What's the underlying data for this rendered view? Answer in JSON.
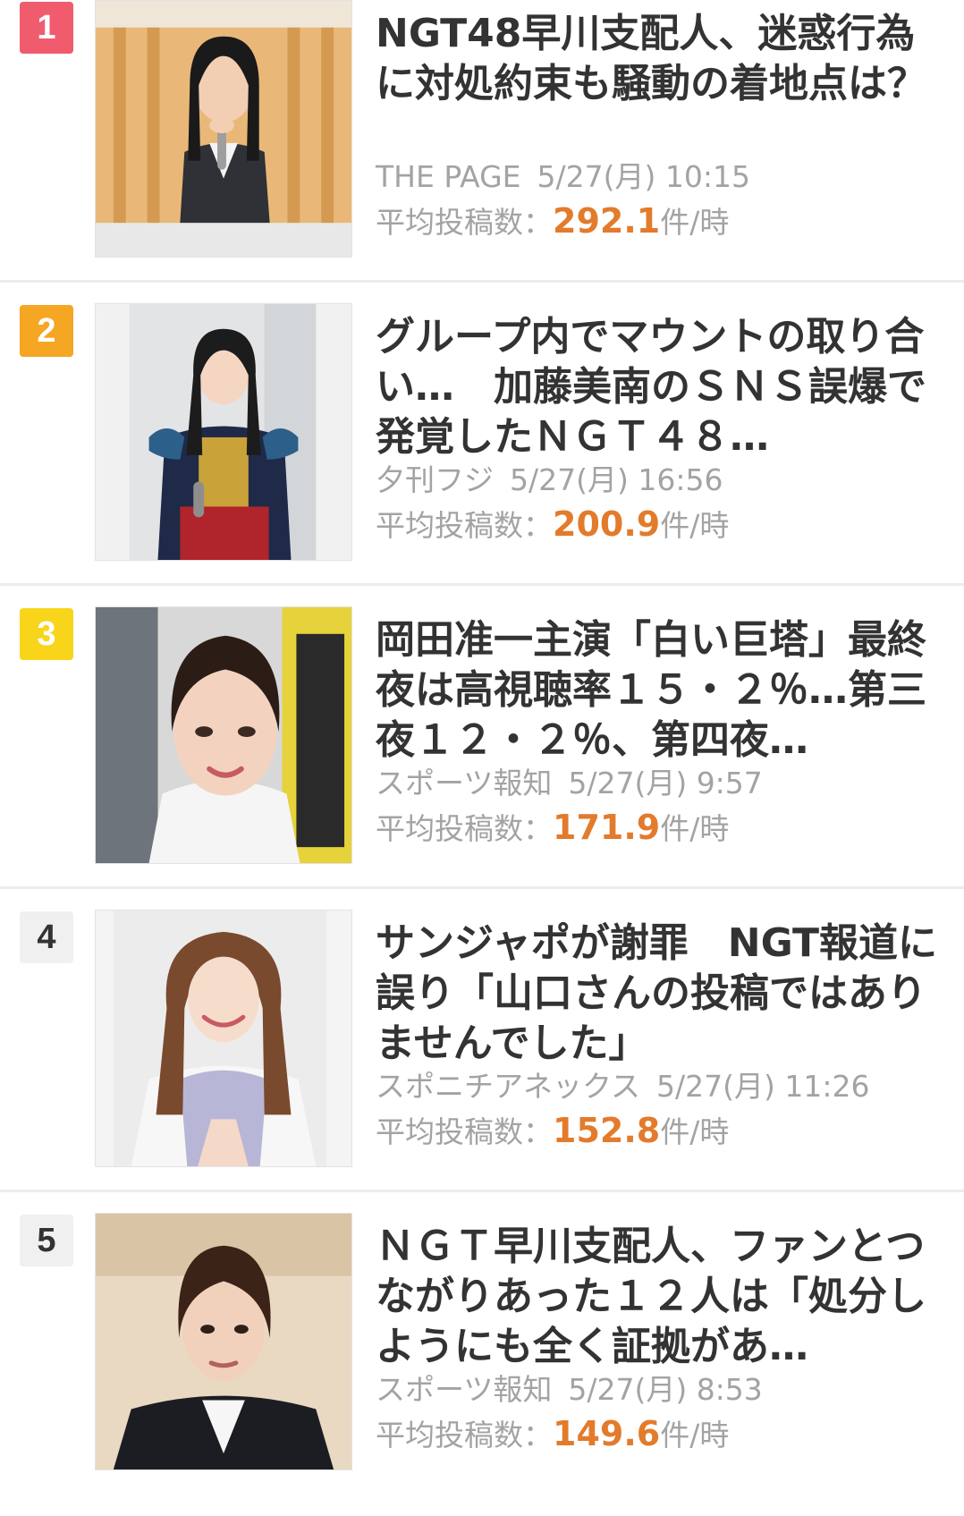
{
  "colors": {
    "rank1": "#f05b6e",
    "rank2": "#f5a623",
    "rank3": "#f8d51b",
    "rank_plain": "#f0f0f0",
    "accent_number": "#e37b2c",
    "meta_text": "#a3a3a3",
    "title_text": "#333333"
  },
  "items": [
    {
      "rank": "1",
      "title": "NGT48早川支配人、迷惑行為に対処約束も騒動の着地点は？",
      "source": "THE PAGE",
      "date": "5/27(月) 10:15",
      "avg_label": "平均投稿数：",
      "avg_value": "292.1",
      "avg_unit": "件/時",
      "thumb_icon": "woman-with-microphone-photo"
    },
    {
      "rank": "2",
      "title": "グループ内でマウントの取り合い…　加藤美南のＳＮＳ誤爆で発覚したＮＧＴ４８…",
      "source": "夕刊フジ",
      "date": "5/27(月) 16:56",
      "avg_label": "平均投稿数：",
      "avg_value": "200.9",
      "avg_unit": "件/時",
      "thumb_icon": "idol-in-costume-photo"
    },
    {
      "rank": "3",
      "title": "岡田准一主演「白い巨塔」最終夜は高視聴率１５・２％…第三夜１２・２％、第四夜…",
      "source": "スポーツ報知",
      "date": "5/27(月) 9:57",
      "avg_label": "平均投稿数：",
      "avg_value": "171.9",
      "avg_unit": "件/時",
      "thumb_icon": "actress-portrait-photo"
    },
    {
      "rank": "4",
      "title": "サンジャポが謝罪　NGT報道に誤り「山口さんの投稿ではありませんでした」",
      "source": "スポニチアネックス",
      "date": "5/27(月) 11:26",
      "avg_label": "平均投稿数：",
      "avg_value": "152.8",
      "avg_unit": "件/時",
      "thumb_icon": "smiling-woman-photo"
    },
    {
      "rank": "5",
      "title": "ＮＧＴ早川支配人、ファンとつながりあった１２人は「処分しようにも全く証拠があ…",
      "source": "スポーツ報知",
      "date": "5/27(月) 8:53",
      "avg_label": "平均投稿数：",
      "avg_value": "149.6",
      "avg_unit": "件/時",
      "thumb_icon": "woman-in-suit-photo"
    }
  ]
}
